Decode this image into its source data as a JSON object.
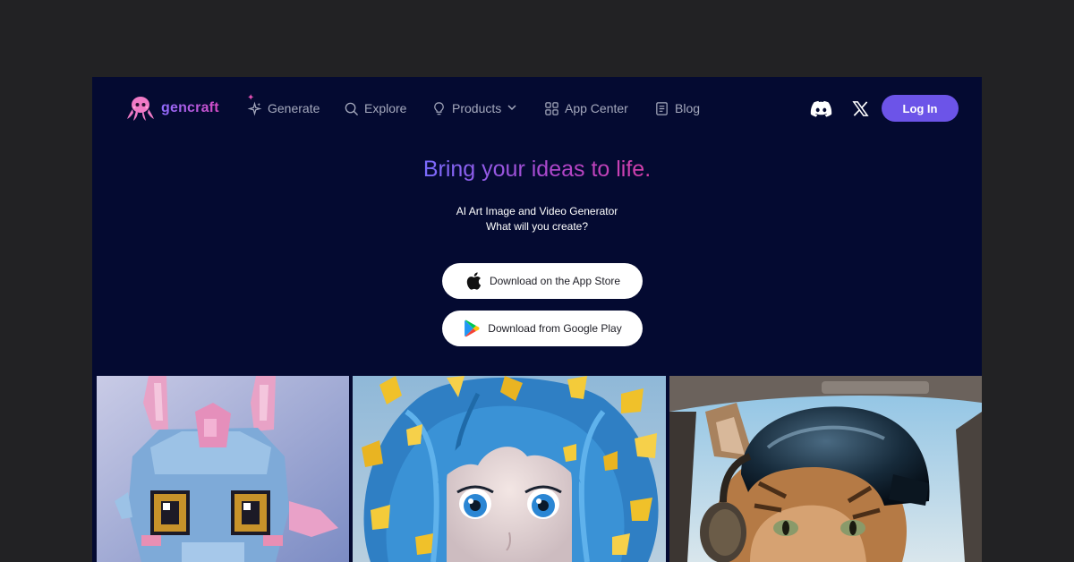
{
  "brand": {
    "name": "gencraft"
  },
  "nav": {
    "items": [
      {
        "label": "Generate",
        "icon": "sparkle-icon"
      },
      {
        "label": "Explore",
        "icon": "search-icon"
      },
      {
        "label": "Products",
        "icon": "lightbulb-icon",
        "has_dropdown": true
      },
      {
        "label": "App Center",
        "icon": "apps-grid-icon"
      },
      {
        "label": "Blog",
        "icon": "document-icon"
      }
    ],
    "social": [
      "discord-icon",
      "x-icon"
    ],
    "login_label": "Log In"
  },
  "hero": {
    "headline": "Bring your ideas to life.",
    "subtitle_line1": "AI Art Image and Video Generator",
    "subtitle_line2": "What will you create?",
    "app_store_label": "Download on the App Store",
    "google_play_label": "Download from Google Play"
  },
  "gallery": {
    "images": [
      "pixel-dragon-image",
      "blue-haired-girl-image",
      "cat-pilot-image"
    ]
  },
  "colors": {
    "background": "#040a31",
    "outer_background": "#222224",
    "accent": "#6c54e8",
    "headline_gradient": [
      "#7a6cff",
      "#d43fa8"
    ],
    "nav_text": "#a5a9bd"
  }
}
